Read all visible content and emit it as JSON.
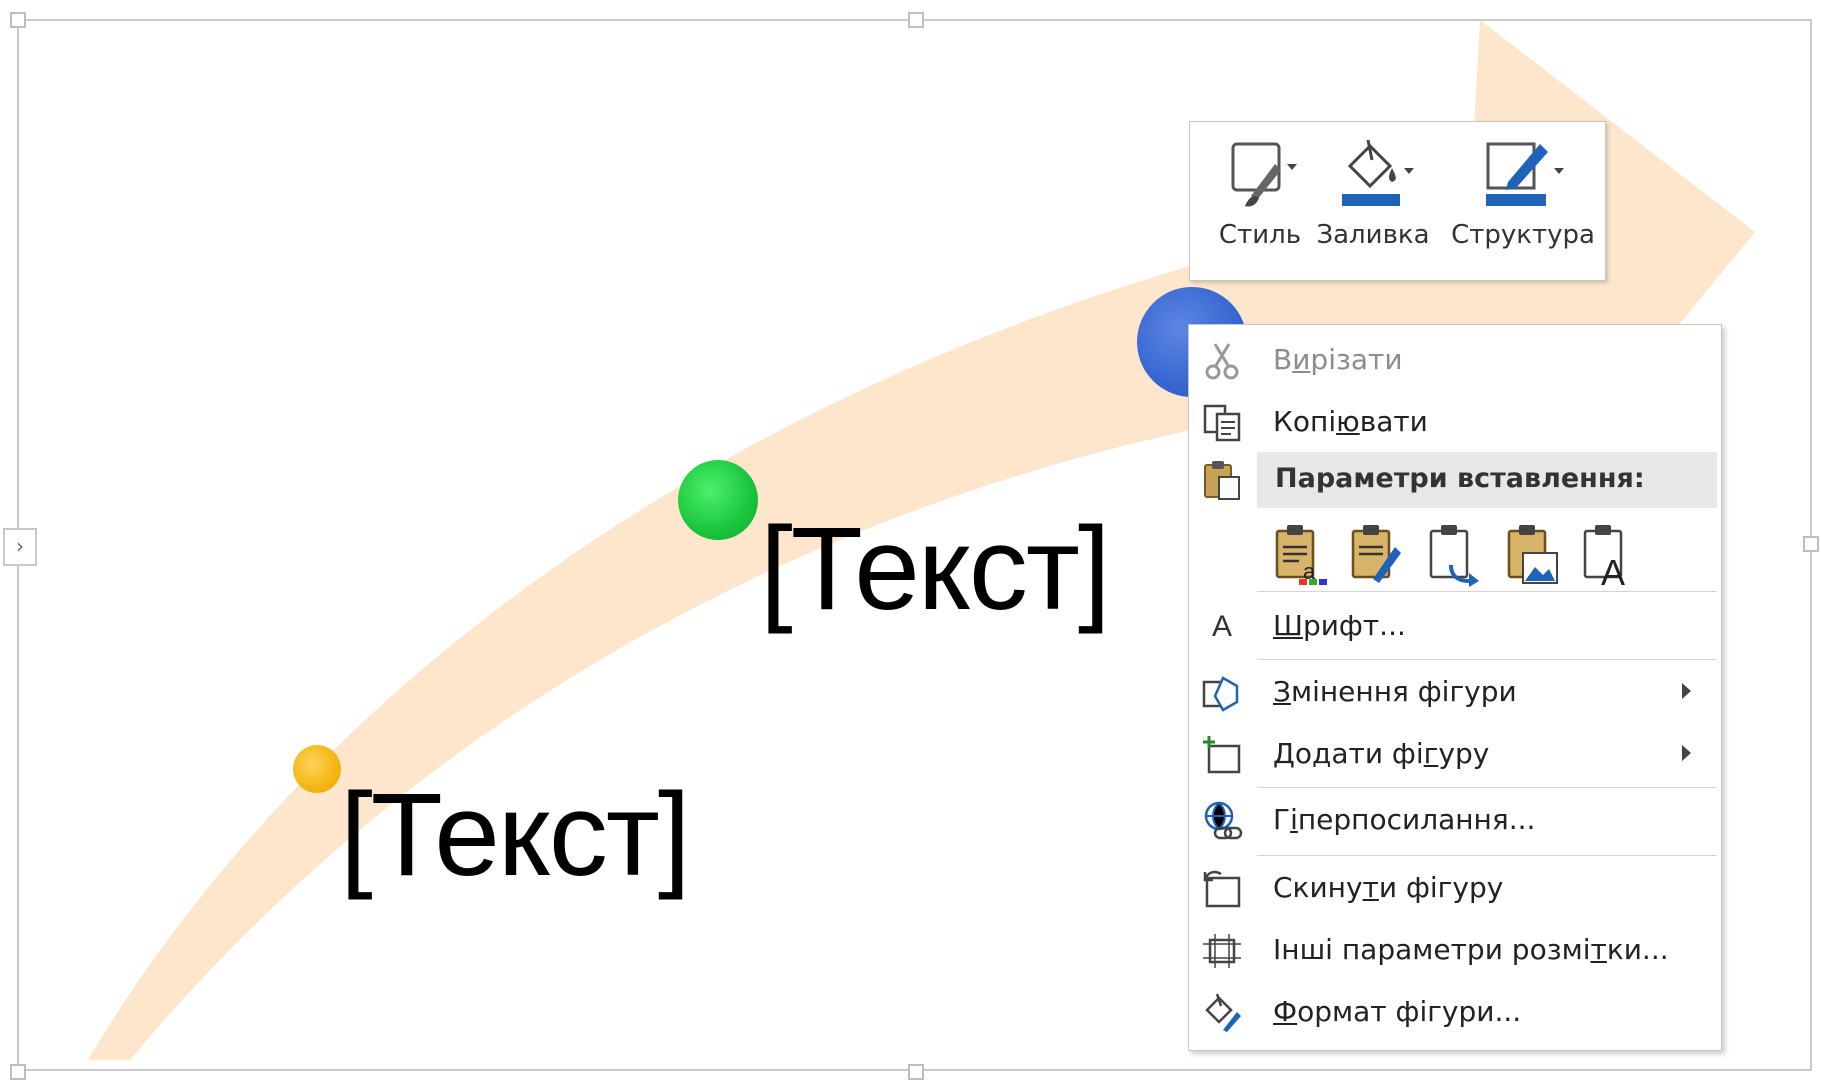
{
  "diagram": {
    "labels": [
      "[Текст]",
      "[Текст]"
    ]
  },
  "mini_toolbar": {
    "buttons": [
      {
        "label": "Стиль",
        "icon": "shape-style-icon"
      },
      {
        "label": "Заливка",
        "icon": "paint-bucket-icon"
      },
      {
        "label": "Структура",
        "icon": "pen-outline-icon"
      }
    ]
  },
  "context_menu": {
    "cut": {
      "label": "Вирізати",
      "pre": "В",
      "key": "и",
      "post": "різати",
      "disabled": true
    },
    "copy": {
      "label": "Копіювати",
      "pre": "Копі",
      "key": "ю",
      "post": "вати"
    },
    "paste_header": "Параметри вставлення:",
    "paste_options": [
      "paste-keep-source-icon",
      "paste-merge-format-icon",
      "paste-link-icon",
      "paste-picture-icon",
      "paste-text-only-icon"
    ],
    "font": {
      "label": "Шрифт...",
      "pre": "",
      "key": "Ш",
      "post": "рифт..."
    },
    "change_shape": {
      "label": "Змінення фігури",
      "pre": "",
      "key": "З",
      "post": "мінення фігури",
      "submenu": true
    },
    "add_shape": {
      "label": "Додати фігуру",
      "pre": "Додати фі",
      "key": "г",
      "post": "уру",
      "submenu": true
    },
    "hyperlink": {
      "label": "Гіперпосилання...",
      "pre": "Г",
      "key": "і",
      "post": "перпосилання..."
    },
    "reset_shape": {
      "label": "Скинути фігуру",
      "pre": "Скину",
      "key": "т",
      "post": "и фігуру"
    },
    "layout_options": {
      "label": "Інші параметри розмітки...",
      "pre": "Інші параметри розмі",
      "key": "т",
      "post": "ки..."
    },
    "format_shape": {
      "label": "Формат фігури...",
      "pre": "",
      "key": "Ф",
      "post": "ормат фігури..."
    }
  },
  "colors": {
    "arrow": "#fde6cc",
    "dot_green": "#1ec940",
    "dot_yellow": "#f3b612",
    "dot_blue": "#3766d2",
    "icon_blue": "#1e63b8"
  }
}
